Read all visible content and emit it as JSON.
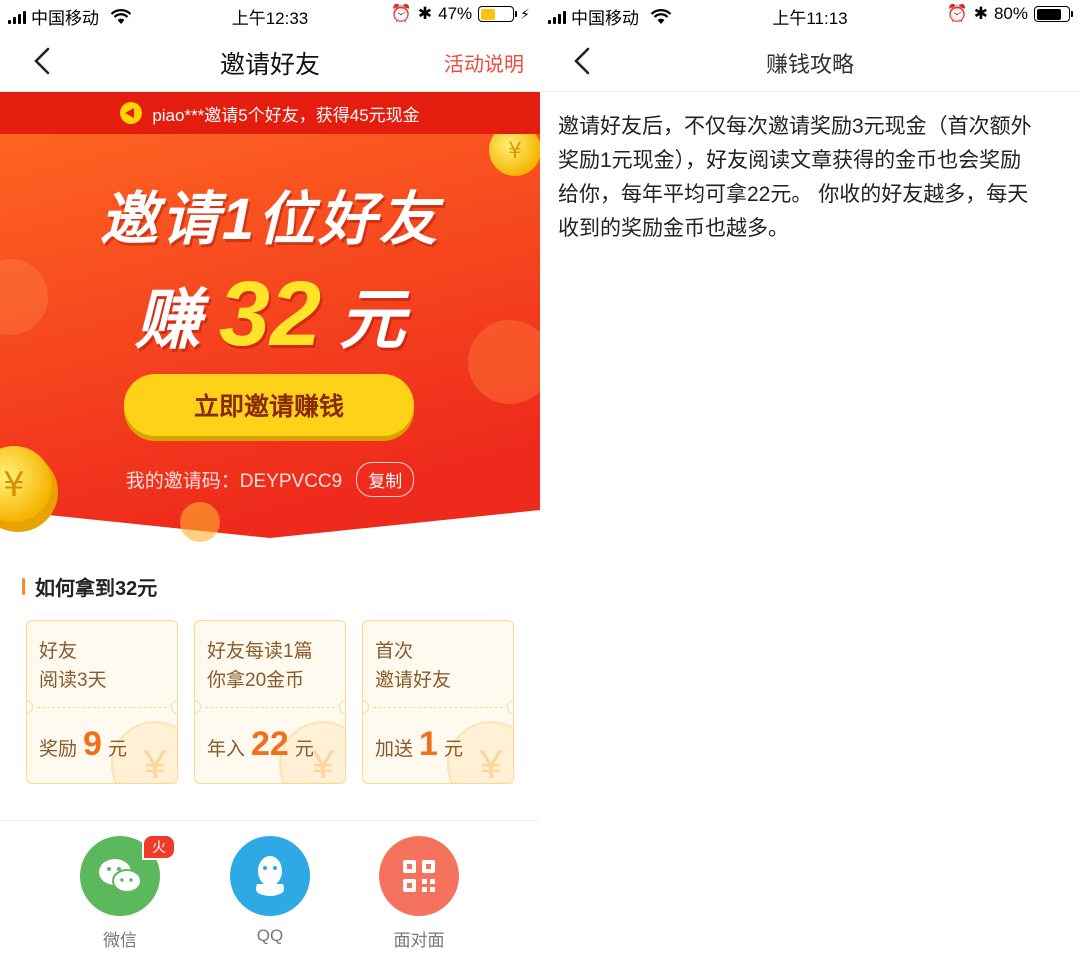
{
  "left": {
    "status": {
      "carrier": "中国移动",
      "time": "上午12:33",
      "battery": "47%",
      "battery_level": 0.47,
      "battery_color": "#ffc20e"
    },
    "nav": {
      "title": "邀请好友",
      "action": "活动说明"
    },
    "marquee": "piao***邀请5个好友，获得45元现金",
    "hero": {
      "line1": "邀请1位好友",
      "earn": "赚",
      "amount": "32",
      "unit": "元"
    },
    "cta": "立即邀请赚钱",
    "invite": {
      "label": "我的邀请码：DEYPVCC9",
      "copy": "复制"
    },
    "section_title": "如何拿到32元",
    "cards": [
      {
        "line1": "好友",
        "line2": "阅读3天",
        "prefix": "奖励",
        "num": "9",
        "unit": "元"
      },
      {
        "line1": "好友每读1篇",
        "line2": "你拿20金币",
        "prefix": "年入",
        "num": "22",
        "unit": "元"
      },
      {
        "line1": "首次",
        "line2": "邀请好友",
        "prefix": "加送",
        "num": "1",
        "unit": "元"
      }
    ],
    "share": [
      {
        "label": "微信",
        "color": "#5cb85c",
        "icon": "wechat-icon",
        "badge": "火"
      },
      {
        "label": "QQ",
        "color": "#2fa8e6",
        "icon": "qq-icon"
      },
      {
        "label": "面对面",
        "color": "#f5725e",
        "icon": "qrcode-icon"
      }
    ],
    "colors": {
      "banner_top": "#ff5a1f",
      "banner_bottom": "#f0281e",
      "accent": "#f04a3a",
      "cta": "#ffd21a"
    }
  },
  "right": {
    "status": {
      "carrier": "中国移动",
      "time": "上午11:13",
      "battery": "80%",
      "battery_level": 0.8,
      "battery_color": "#000000"
    },
    "nav": {
      "title": "赚钱攻略"
    },
    "article": "邀请好友后，不仅每次邀请奖励3元现金（首次额外奖励1元现金），好友阅读文章获得的金币也会奖励给你，每年平均可拿22元。 你收的好友越多，每天收到的奖励金币也越多。"
  }
}
